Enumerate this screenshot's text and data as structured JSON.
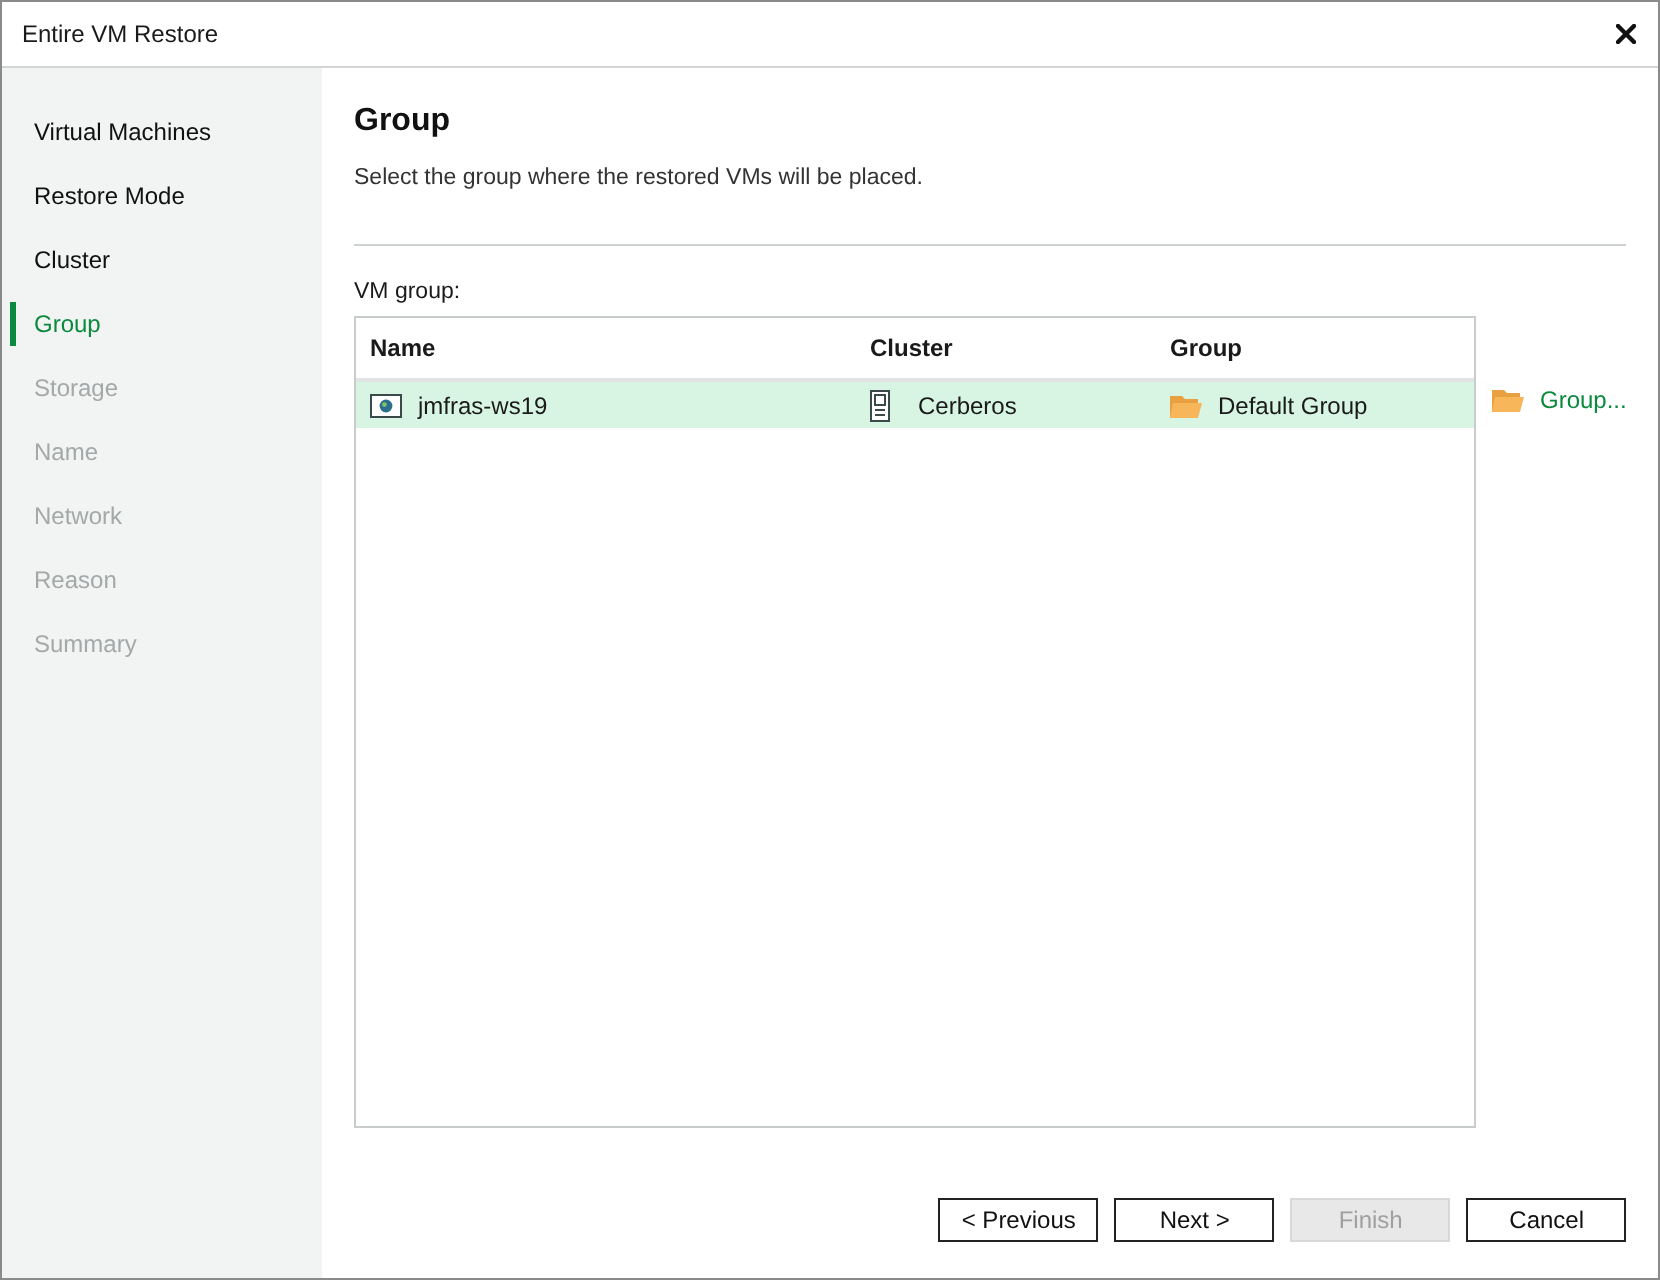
{
  "window": {
    "title": "Entire VM Restore"
  },
  "sidebar": {
    "items": [
      {
        "label": "Virtual Machines",
        "selected": false,
        "disabled": false
      },
      {
        "label": "Restore Mode",
        "selected": false,
        "disabled": false
      },
      {
        "label": "Cluster",
        "selected": false,
        "disabled": false
      },
      {
        "label": "Group",
        "selected": true,
        "disabled": false
      },
      {
        "label": "Storage",
        "selected": false,
        "disabled": true
      },
      {
        "label": "Name",
        "selected": false,
        "disabled": true
      },
      {
        "label": "Network",
        "selected": false,
        "disabled": true
      },
      {
        "label": "Reason",
        "selected": false,
        "disabled": true
      },
      {
        "label": "Summary",
        "selected": false,
        "disabled": true
      }
    ]
  },
  "page": {
    "heading": "Group",
    "description": "Select the group where the restored VMs will be placed."
  },
  "vm_group": {
    "label": "VM group:",
    "table": {
      "columns": [
        "Name",
        "Cluster",
        "Group"
      ],
      "rows": [
        {
          "name": "jmfras-ws19",
          "cluster": "Cerberos",
          "group": "Default Group",
          "selected": true
        }
      ]
    },
    "group_link": "Group..."
  },
  "buttons": [
    {
      "label": "< Previous",
      "disabled": false
    },
    {
      "label": "Next >",
      "disabled": false
    },
    {
      "label": "Finish",
      "disabled": true
    },
    {
      "label": "Cancel",
      "disabled": false
    }
  ]
}
